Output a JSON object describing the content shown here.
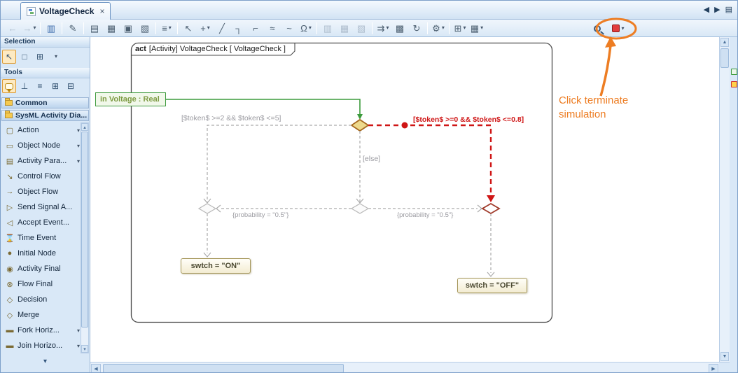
{
  "tab": {
    "title": "VoltageCheck",
    "close_icon": "×"
  },
  "tab_nav": {
    "prev": "◀",
    "next": "▶",
    "list": "▤"
  },
  "icons": {
    "dropdown": "▾",
    "up": "▲",
    "down": "▼",
    "left": "◀",
    "right": "▶",
    "small_up": "▴",
    "small_down": "▾",
    "expand": "▾"
  },
  "colors": {
    "annotation_orange": "#ed7d23",
    "active_path_red": "#cf1616",
    "input_green": "#3f9b3f",
    "decision_gold": "#b8860b"
  },
  "toolbar": {
    "buttons": [
      {
        "name": "nav-back",
        "glyph": "←"
      },
      {
        "name": "nav-forward",
        "glyph": "→"
      },
      {
        "name": "open-diagram-windows",
        "glyph": "▥"
      },
      {
        "name": "edit-properties",
        "glyph": "✎"
      },
      {
        "name": "print",
        "glyph": "▤"
      },
      {
        "name": "clipboard",
        "glyph": "▦"
      },
      {
        "name": "copy",
        "glyph": "▣"
      },
      {
        "name": "paste",
        "glyph": "▧"
      },
      {
        "name": "related-elements",
        "glyph": "≡"
      },
      {
        "name": "select-path",
        "glyph": "↖"
      },
      {
        "name": "add-shape",
        "glyph": "+"
      },
      {
        "name": "line-diagonal",
        "glyph": "╱"
      },
      {
        "name": "line-rectilinear",
        "glyph": "┐"
      },
      {
        "name": "line-rounded",
        "glyph": "⌐"
      },
      {
        "name": "line-curved",
        "glyph": "≈"
      },
      {
        "name": "line-zigzag",
        "glyph": "~"
      },
      {
        "name": "line-jumps",
        "glyph": "Ω"
      },
      {
        "name": "align-shapes",
        "glyph": "▥"
      },
      {
        "name": "distribute-shapes",
        "glyph": "▦"
      },
      {
        "name": "same-size-shapes",
        "glyph": "▧"
      },
      {
        "name": "dependencies",
        "glyph": "⇉"
      },
      {
        "name": "copy-as-image",
        "glyph": "▩"
      },
      {
        "name": "refresh",
        "glyph": "↻"
      },
      {
        "name": "diagram-options",
        "glyph": "⚙"
      },
      {
        "name": "grid-options",
        "glyph": "⊞"
      },
      {
        "name": "table-view",
        "glyph": "▦"
      }
    ]
  },
  "sidebar": {
    "selection_header": "Selection",
    "tools_header": "Tools",
    "common_header": "Common",
    "palette_header": "SysML Activity Dia...",
    "selection_tools": [
      {
        "name": "select-tool",
        "glyph": "↖"
      },
      {
        "name": "marquee-select-tool",
        "glyph": "□"
      },
      {
        "name": "group-select-tool",
        "glyph": "⊞"
      }
    ],
    "tools_tools": [
      {
        "name": "anchor-tool",
        "glyph": "⊥"
      },
      {
        "name": "structure-tool",
        "glyph": "≡"
      },
      {
        "name": "legend-tool",
        "glyph": "⊞"
      },
      {
        "name": "zoom-tool",
        "glyph": "⊟"
      }
    ],
    "palette_items": [
      {
        "label": "Action",
        "glyph": "▢"
      },
      {
        "label": "Object Node",
        "glyph": "▭"
      },
      {
        "label": "Activity Para...",
        "glyph": "▤"
      },
      {
        "label": "Control Flow",
        "glyph": "↘"
      },
      {
        "label": "Object Flow",
        "glyph": "→"
      },
      {
        "label": "Send Signal A...",
        "glyph": "▷"
      },
      {
        "label": "Accept Event...",
        "glyph": "◁"
      },
      {
        "label": "Time Event",
        "glyph": "⌛"
      },
      {
        "label": "Initial Node",
        "glyph": "●"
      },
      {
        "label": "Activity Final",
        "glyph": "◉"
      },
      {
        "label": "Flow Final",
        "glyph": "⊗"
      },
      {
        "label": "Decision",
        "glyph": "◇"
      },
      {
        "label": "Merge",
        "glyph": "◇"
      },
      {
        "label": "Fork Horiz...",
        "glyph": "▬"
      },
      {
        "label": "Join Horizo...",
        "glyph": "▬"
      }
    ]
  },
  "diagram": {
    "frame_keyword": "act",
    "frame_title": "[Activity] VoltageCheck [ VoltageCheck ]",
    "pin_label": "in Voltage : Real",
    "guard_left": "[$token$ >=2 && $token$ <=5]",
    "guard_right": "[$token$ >=0 && $token$ <=0.8]",
    "guard_else": "[else]",
    "prob_left": "{probability = \"0.5\"}",
    "prob_right": "{probability = \"0.5\"}",
    "action_on": "swtch = \"ON\"",
    "action_off": "swtch = \"OFF\""
  },
  "annotation": {
    "line1": "Click terminate",
    "line2": "simulation"
  }
}
